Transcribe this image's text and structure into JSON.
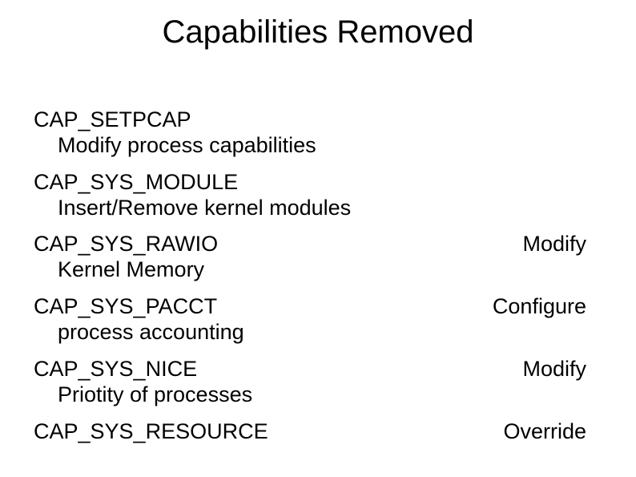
{
  "title": "Capabilities Removed",
  "entries": [
    {
      "cap": "CAP_SETPCAP",
      "right": "",
      "desc": "Modify process capabilities"
    },
    {
      "cap": "CAP_SYS_MODULE",
      "right": "",
      "desc": "Insert/Remove kernel modules"
    },
    {
      "cap": "CAP_SYS_RAWIO",
      "right": "Modify",
      "desc": "Kernel Memory"
    },
    {
      "cap": "CAP_SYS_PACCT",
      "right": "Configure",
      "desc": "process accounting"
    },
    {
      "cap": "CAP_SYS_NICE",
      "right": "Modify",
      "desc": "Priotity of processes"
    },
    {
      "cap": "CAP_SYS_RESOURCE",
      "right": "Override",
      "desc": ""
    }
  ]
}
